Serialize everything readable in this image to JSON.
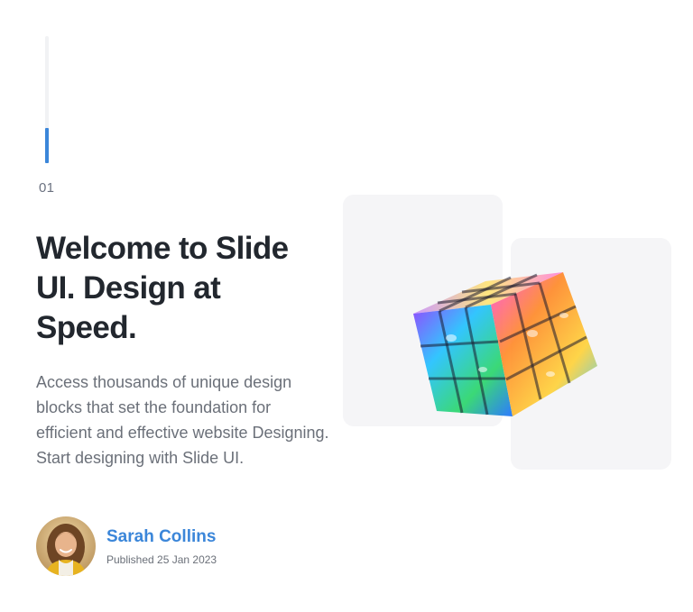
{
  "slide": {
    "number": "01",
    "progress_fraction": 0.28
  },
  "hero": {
    "headline": "Welcome to Slide UI. Design at Speed.",
    "description": "Access thousands of unique design blocks that set the foundation for efficient and effective website Designing. Start designing with Slide UI."
  },
  "author": {
    "name": "Sarah Collins",
    "published": "Published 25 Jan 2023"
  },
  "colors": {
    "accent": "#3b86d9",
    "heading": "#22272e",
    "body_text": "#6b7079",
    "card_bg": "#f5f5f7"
  },
  "icons": {
    "illustration": "glass-rubiks-cube-illustration"
  }
}
